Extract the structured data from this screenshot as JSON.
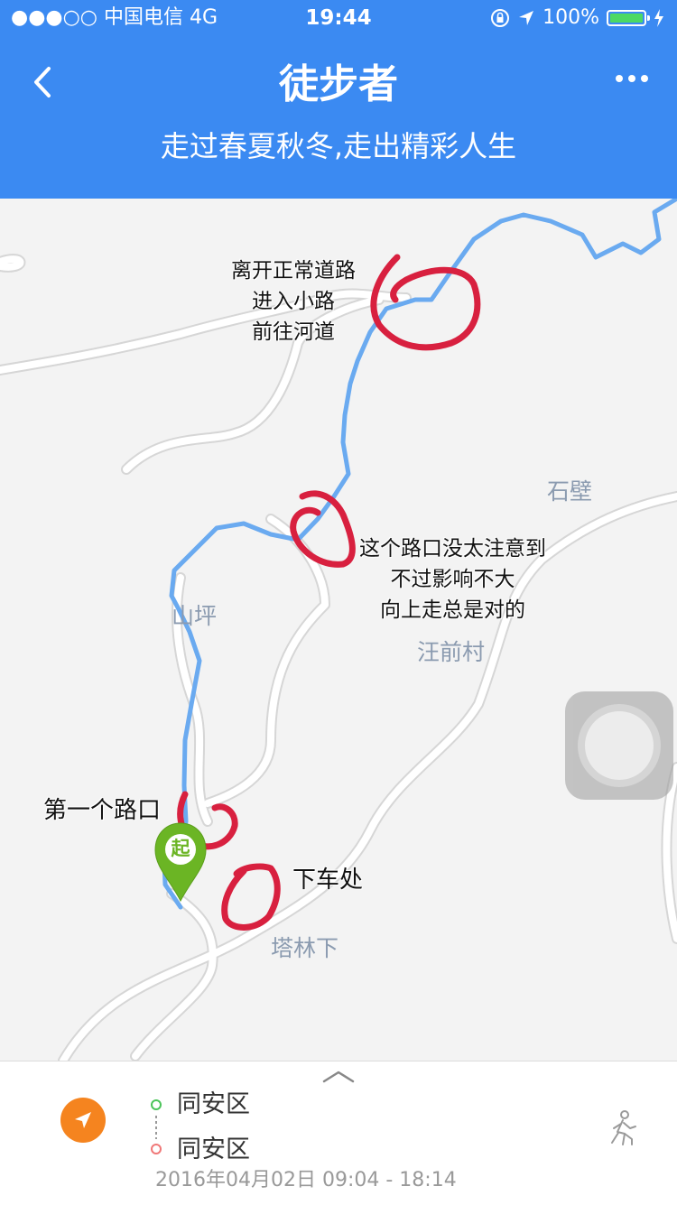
{
  "status_bar": {
    "carrier": "●●●○○ 中国电信  4G",
    "time": "19:44",
    "battery": "100%",
    "battery_level": 1.0
  },
  "header": {
    "title": "徒步者",
    "subtitle": "走过春夏秋冬,走出精彩人生",
    "back_icon": "chevron-left-icon",
    "more_icon": "more-dots-icon",
    "background": "#3b8af2"
  },
  "map": {
    "labels": {
      "shibi": "石壁",
      "shanping": "山坪",
      "wangqiancun": "汪前村",
      "talinxia": "塔林下"
    },
    "annotations": {
      "top": [
        "离开正常道路",
        "进入小路",
        "前往河道"
      ],
      "middle": [
        "这个路口没太注意到",
        "不过影响不大",
        "向上走总是对的"
      ],
      "first_turn": "第一个路口",
      "dropoff": "下车处"
    },
    "start_marker": "起",
    "track_color": "#6aaaf0",
    "circle_color": "#d8203f",
    "marker_color": "#6bb524"
  },
  "panel": {
    "start_location": "同安区",
    "end_location": "同安区",
    "time_range": "2016年04月02日 09:04 - 18:14",
    "nav_color": "#f5841f"
  }
}
